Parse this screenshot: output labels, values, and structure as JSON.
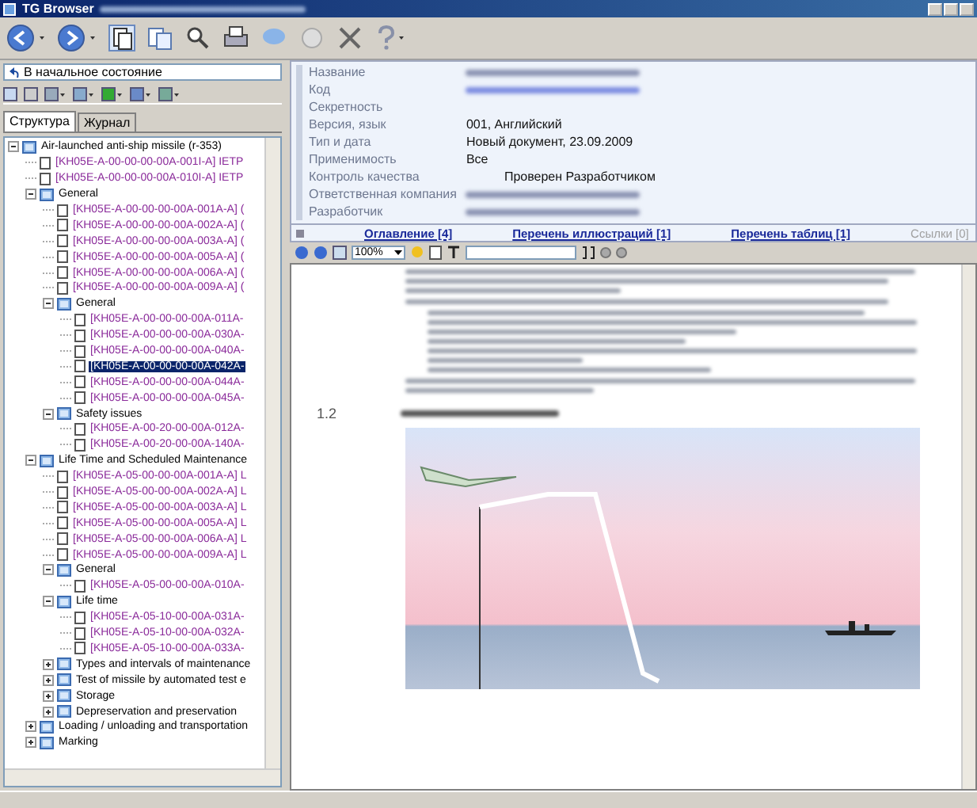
{
  "window": {
    "title": "TG Browser"
  },
  "left_panel": {
    "reset_button": "В начальное состояние",
    "tabs": [
      {
        "label": "Структура",
        "selected": true
      },
      {
        "label": "Журнал",
        "selected": false
      }
    ],
    "tree": [
      {
        "label": "Air-launched anti-ship missile (r-353)",
        "kind": "folder",
        "expanded": true,
        "selected": false,
        "children": [
          {
            "label": "[KH05E-A-00-00-00-00A-001I-A] IETP",
            "kind": "doc",
            "selected": false
          },
          {
            "label": "[KH05E-A-00-00-00-00A-010I-A] IETP",
            "kind": "doc",
            "selected": false
          },
          {
            "label": "General",
            "kind": "folder",
            "expanded": true,
            "selected": false,
            "children": [
              {
                "label": "[KH05E-A-00-00-00-00A-001A-A] (",
                "kind": "doc",
                "selected": false
              },
              {
                "label": "[KH05E-A-00-00-00-00A-002A-A] (",
                "kind": "doc",
                "selected": false
              },
              {
                "label": "[KH05E-A-00-00-00-00A-003A-A] (",
                "kind": "doc",
                "selected": false
              },
              {
                "label": "[KH05E-A-00-00-00-00A-005A-A] (",
                "kind": "doc",
                "selected": false
              },
              {
                "label": "[KH05E-A-00-00-00-00A-006A-A] (",
                "kind": "doc",
                "selected": false
              },
              {
                "label": "[KH05E-A-00-00-00-00A-009A-A] (",
                "kind": "doc",
                "selected": false
              },
              {
                "label": "General",
                "kind": "folder",
                "expanded": true,
                "selected": false,
                "children": [
                  {
                    "label": "[KH05E-A-00-00-00-00A-011A-",
                    "kind": "doc",
                    "selected": false
                  },
                  {
                    "label": "[KH05E-A-00-00-00-00A-030A-",
                    "kind": "doc",
                    "selected": false
                  },
                  {
                    "label": "[KH05E-A-00-00-00-00A-040A-",
                    "kind": "doc",
                    "selected": false
                  },
                  {
                    "label": "[KH05E-A-00-00-00-00A-042A-",
                    "kind": "doc",
                    "selected": true
                  },
                  {
                    "label": "[KH05E-A-00-00-00-00A-044A-",
                    "kind": "doc",
                    "selected": false
                  },
                  {
                    "label": "[KH05E-A-00-00-00-00A-045A-",
                    "kind": "doc",
                    "selected": false
                  }
                ]
              },
              {
                "label": "Safety issues",
                "kind": "folder",
                "expanded": true,
                "selected": false,
                "children": [
                  {
                    "label": "[KH05E-A-00-20-00-00A-012A-",
                    "kind": "doc",
                    "selected": false
                  },
                  {
                    "label": "[KH05E-A-00-20-00-00A-140A-",
                    "kind": "doc",
                    "selected": false
                  }
                ]
              }
            ]
          },
          {
            "label": "Life Time and Scheduled Maintenance",
            "kind": "folder",
            "expanded": true,
            "selected": false,
            "children": [
              {
                "label": "[KH05E-A-05-00-00-00A-001A-A] L",
                "kind": "doc",
                "selected": false
              },
              {
                "label": "[KH05E-A-05-00-00-00A-002A-A] L",
                "kind": "doc",
                "selected": false
              },
              {
                "label": "[KH05E-A-05-00-00-00A-003A-A] L",
                "kind": "doc",
                "selected": false
              },
              {
                "label": "[KH05E-A-05-00-00-00A-005A-A] L",
                "kind": "doc",
                "selected": false
              },
              {
                "label": "[KH05E-A-05-00-00-00A-006A-A] L",
                "kind": "doc",
                "selected": false
              },
              {
                "label": "[KH05E-A-05-00-00-00A-009A-A] L",
                "kind": "doc",
                "selected": false
              },
              {
                "label": "General",
                "kind": "folder",
                "expanded": true,
                "selected": false,
                "children": [
                  {
                    "label": "[KH05E-A-05-00-00-00A-010A-",
                    "kind": "doc",
                    "selected": false
                  }
                ]
              },
              {
                "label": "Life time",
                "kind": "folder",
                "expanded": true,
                "selected": false,
                "children": [
                  {
                    "label": "[KH05E-A-05-10-00-00A-031A-",
                    "kind": "doc",
                    "selected": false
                  },
                  {
                    "label": "[KH05E-A-05-10-00-00A-032A-",
                    "kind": "doc",
                    "selected": false
                  },
                  {
                    "label": "[KH05E-A-05-10-00-00A-033A-",
                    "kind": "doc",
                    "selected": false
                  }
                ]
              },
              {
                "label": "Types and intervals of maintenance",
                "kind": "folder",
                "expanded": false,
                "selected": false
              },
              {
                "label": "Test of missile by automated test e",
                "kind": "folder",
                "expanded": false,
                "selected": false
              },
              {
                "label": "Storage",
                "kind": "folder",
                "expanded": false,
                "selected": false
              },
              {
                "label": "Depreservation and preservation",
                "kind": "folder",
                "expanded": false,
                "selected": false
              }
            ]
          },
          {
            "label": "Loading / unloading and transportation",
            "kind": "folder",
            "expanded": false,
            "selected": false
          },
          {
            "label": "Marking",
            "kind": "folder",
            "expanded": false,
            "selected": false
          }
        ]
      }
    ]
  },
  "header": {
    "fields": [
      {
        "label": "Название",
        "blurred": true
      },
      {
        "label": "Код",
        "blurred": true
      },
      {
        "label": "Секретность",
        "blurred": false
      },
      {
        "label": "Версия, язык",
        "value": "001, Английский",
        "blurred": false
      },
      {
        "label": "Тип и дата",
        "value": "Новый документ, 23.09.2009",
        "blurred": false
      },
      {
        "label": "Применимость",
        "value": "Все",
        "blurred": false
      },
      {
        "label": "Контроль качества",
        "value": "Проверен Разработчиком",
        "blurred": false
      },
      {
        "label": "Ответственная компания",
        "blurred": true
      },
      {
        "label": "Разработчик",
        "blurred": true
      }
    ],
    "links": [
      {
        "label": "Оглавление [4]",
        "disabled": false
      },
      {
        "label": "Перечень иллюстраций [1]",
        "disabled": false
      },
      {
        "label": "Перечень таблиц [1]",
        "disabled": false
      },
      {
        "label": "Ссылки [0]",
        "disabled": true
      }
    ]
  },
  "doc_toolbar": {
    "zoom": "100%"
  },
  "document": {
    "section_number": "1.2"
  }
}
